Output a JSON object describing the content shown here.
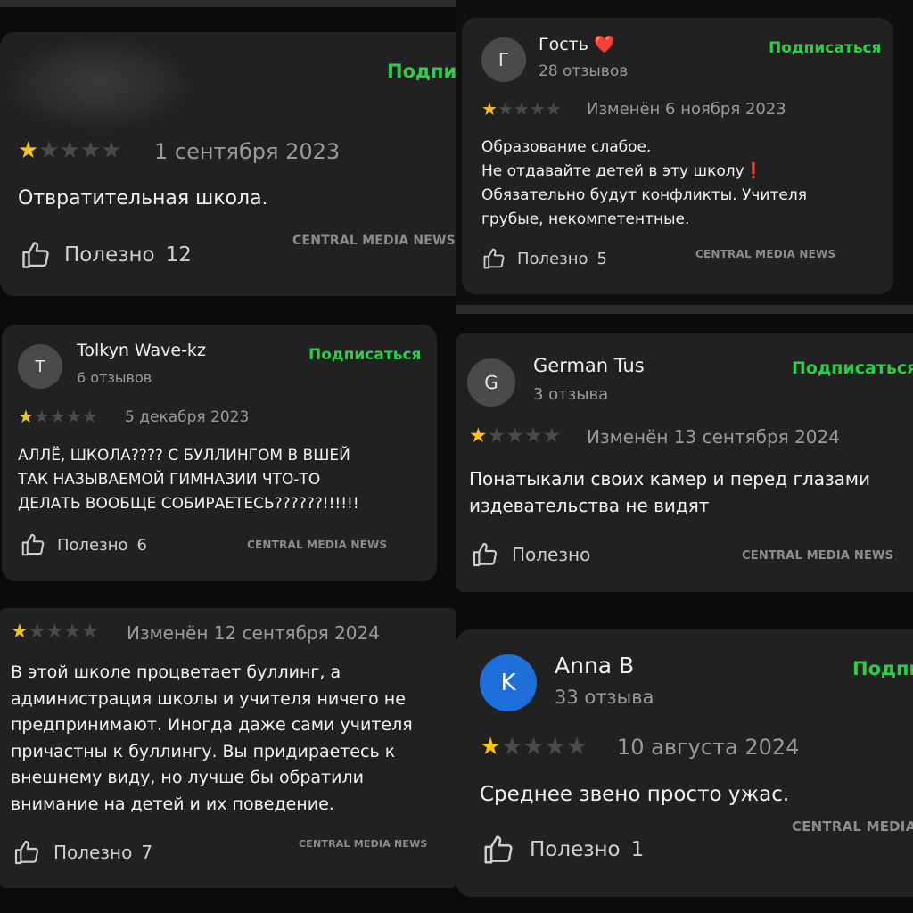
{
  "colors": {
    "accent_green": "#2fcc4a",
    "star_filled": "#f5c11a",
    "star_empty": "#4a4a4a",
    "card_bg": "#212121",
    "avatar_blue": "#1e6fd9"
  },
  "rating_icons": {
    "filled": "★",
    "empty": "★"
  },
  "useful_icon": "thumbs-up-icon",
  "watermark": "CENTRAL MEDIA NEWS",
  "subscribe_full": "Подписаться",
  "subscribe_cut": "Подпи",
  "watermark_cut": "CENTRAL MEDIA NEWS",
  "watermark_cut2": "CENTRAL MEDIA",
  "reviews": [
    {
      "rating": 1,
      "date": "1 сентября 2023",
      "text": "Отвратительная школа.",
      "useful_label": "Полезно",
      "useful_count": "12"
    },
    {
      "avatar_letter": "Г",
      "author": "Гость",
      "author_emoji": "❤️",
      "reviews_count": "28 отзывов",
      "rating": 1,
      "date": "Изменён 6 ноября 2023",
      "text": "Образование слабое.\nНе отдавайте детей в эту школу❗\nОбязательно будут конфликты. Учителя\nгрубые, некомпетентные.",
      "useful_label": "Полезно",
      "useful_count": "5"
    },
    {
      "avatar_letter": "T",
      "author": "Tolkyn Wave-kz",
      "reviews_count": "6 отзывов",
      "rating": 1,
      "date": "5 декабря 2023",
      "text": "АЛЛЁ, ШКОЛА???? С БУЛЛИНГОМ В ВШЕЙ\nТАК НАЗЫВАЕМОЙ ГИМНАЗИИ ЧТО-ТО\nДЕЛАТЬ ВООБЩЕ СОБИРАЕТЕСЬ??????!!!!!!",
      "useful_label": "Полезно",
      "useful_count": "6"
    },
    {
      "avatar_letter": "G",
      "author": "German Tus",
      "reviews_count": "3 отзыва",
      "rating": 1,
      "date": "Изменён 13 сентября 2024",
      "text": "Понатыкали своих камер и перед глазами\nиздевательства не видят",
      "useful_label": "Полезно",
      "useful_count": ""
    },
    {
      "rating": 1,
      "date": "Изменён 12 сентября 2024",
      "text": "В этой школе процветает буллинг, а\nадминистрация школы и учителя ничего не\nпредпринимают. Иногда даже сами учителя\nпричастны к буллингу. Вы придираетесь к\nвнешнему виду, но лучше бы обратили\nвнимание на детей и их поведение.",
      "useful_label": "Полезно",
      "useful_count": "7"
    },
    {
      "avatar_letter": "K",
      "author": "Anna B",
      "reviews_count": "33 отзыва",
      "rating": 1,
      "date": "10 августа 2024",
      "text": "Среднее звено просто ужас.",
      "useful_label": "Полезно",
      "useful_count": "1"
    }
  ]
}
